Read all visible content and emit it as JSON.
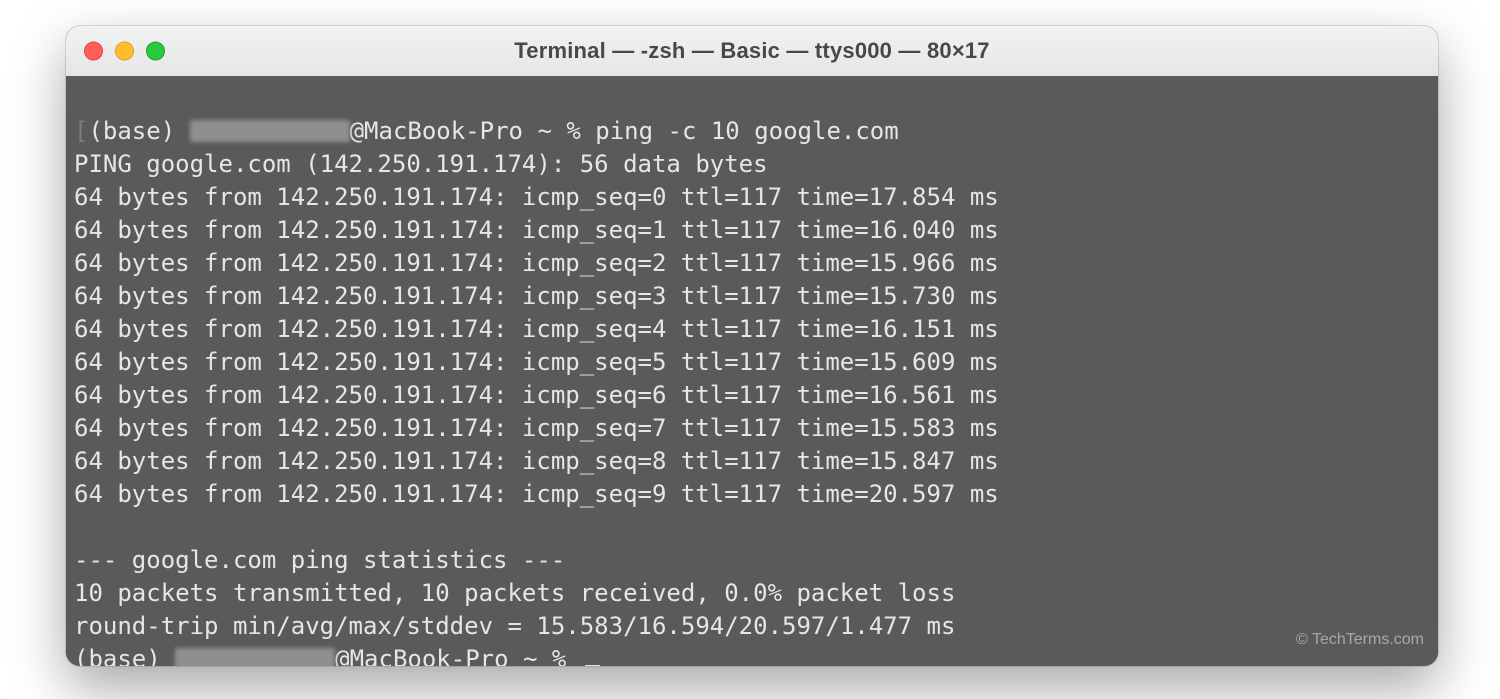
{
  "window": {
    "title": "Terminal — -zsh — Basic — ttys000 — 80×17"
  },
  "prompt": {
    "env": "(base) ",
    "at_host": "@MacBook-Pro ~ % ",
    "command": "ping -c 10 google.com"
  },
  "ping": {
    "header": "PING google.com (142.250.191.174): 56 data bytes",
    "host": "google.com",
    "ip": "142.250.191.174",
    "data_bytes": 56,
    "replies": [
      {
        "bytes": 64,
        "from": "142.250.191.174",
        "icmp_seq": 0,
        "ttl": 117,
        "time_ms": 17.854
      },
      {
        "bytes": 64,
        "from": "142.250.191.174",
        "icmp_seq": 1,
        "ttl": 117,
        "time_ms": 16.04
      },
      {
        "bytes": 64,
        "from": "142.250.191.174",
        "icmp_seq": 2,
        "ttl": 117,
        "time_ms": 15.966
      },
      {
        "bytes": 64,
        "from": "142.250.191.174",
        "icmp_seq": 3,
        "ttl": 117,
        "time_ms": 15.73
      },
      {
        "bytes": 64,
        "from": "142.250.191.174",
        "icmp_seq": 4,
        "ttl": 117,
        "time_ms": 16.151
      },
      {
        "bytes": 64,
        "from": "142.250.191.174",
        "icmp_seq": 5,
        "ttl": 117,
        "time_ms": 15.609
      },
      {
        "bytes": 64,
        "from": "142.250.191.174",
        "icmp_seq": 6,
        "ttl": 117,
        "time_ms": 16.561
      },
      {
        "bytes": 64,
        "from": "142.250.191.174",
        "icmp_seq": 7,
        "ttl": 117,
        "time_ms": 15.583
      },
      {
        "bytes": 64,
        "from": "142.250.191.174",
        "icmp_seq": 8,
        "ttl": 117,
        "time_ms": 15.847
      },
      {
        "bytes": 64,
        "from": "142.250.191.174",
        "icmp_seq": 9,
        "ttl": 117,
        "time_ms": 20.597
      }
    ],
    "reply_lines": [
      "64 bytes from 142.250.191.174: icmp_seq=0 ttl=117 time=17.854 ms",
      "64 bytes from 142.250.191.174: icmp_seq=1 ttl=117 time=16.040 ms",
      "64 bytes from 142.250.191.174: icmp_seq=2 ttl=117 time=15.966 ms",
      "64 bytes from 142.250.191.174: icmp_seq=3 ttl=117 time=15.730 ms",
      "64 bytes from 142.250.191.174: icmp_seq=4 ttl=117 time=16.151 ms",
      "64 bytes from 142.250.191.174: icmp_seq=5 ttl=117 time=15.609 ms",
      "64 bytes from 142.250.191.174: icmp_seq=6 ttl=117 time=16.561 ms",
      "64 bytes from 142.250.191.174: icmp_seq=7 ttl=117 time=15.583 ms",
      "64 bytes from 142.250.191.174: icmp_seq=8 ttl=117 time=15.847 ms",
      "64 bytes from 142.250.191.174: icmp_seq=9 ttl=117 time=20.597 ms"
    ],
    "stats_header": "--- google.com ping statistics ---",
    "summary": {
      "line": "10 packets transmitted, 10 packets received, 0.0% packet loss",
      "transmitted": 10,
      "received": 10,
      "loss_pct": 0.0
    },
    "rtt": {
      "line": "round-trip min/avg/max/stddev = 15.583/16.594/20.597/1.477 ms",
      "min_ms": 15.583,
      "avg_ms": 16.594,
      "max_ms": 20.597,
      "stddev_ms": 1.477
    }
  },
  "watermark": "© TechTerms.com"
}
